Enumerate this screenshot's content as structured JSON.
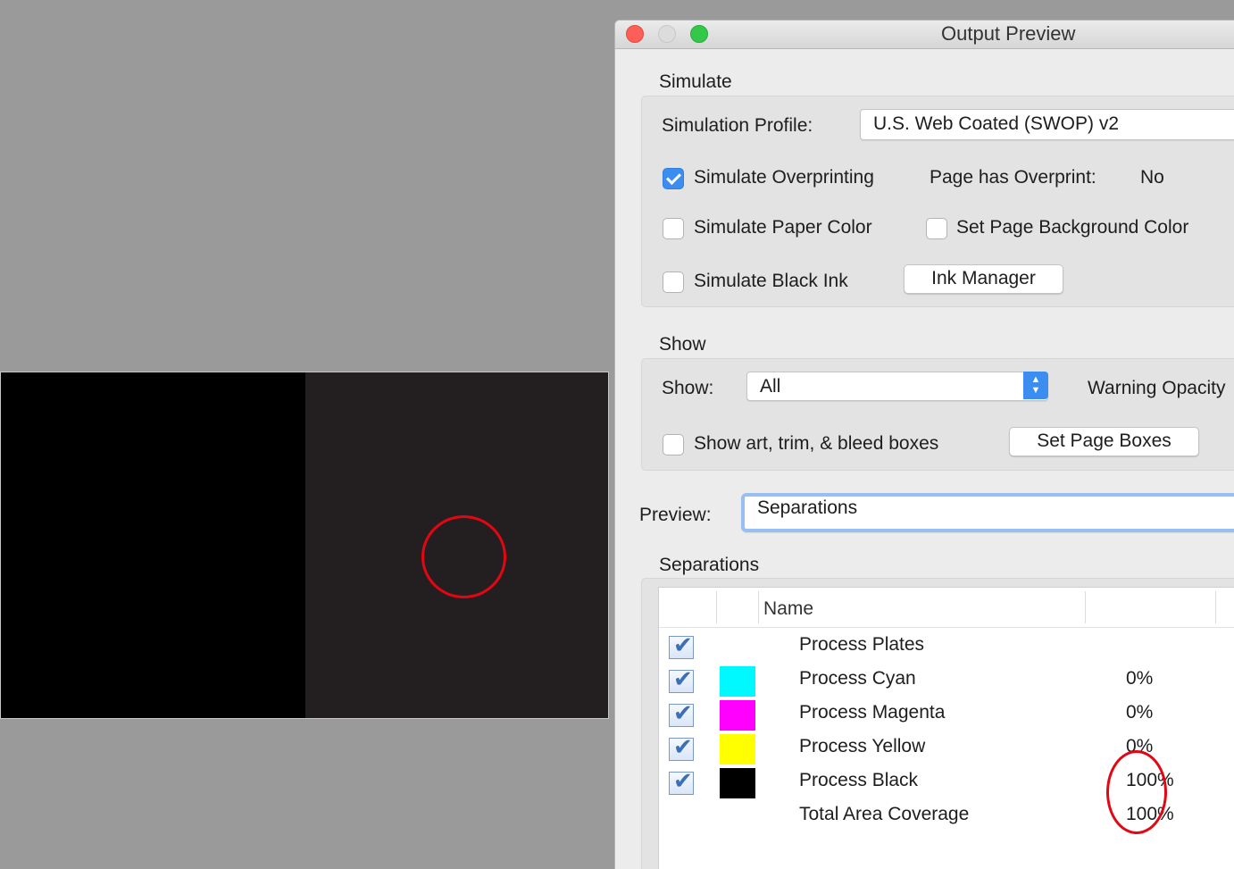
{
  "window": {
    "title": "Output Preview"
  },
  "simulate": {
    "section_label": "Simulate",
    "profile_label": "Simulation Profile:",
    "profile_value": "U.S. Web Coated (SWOP) v2",
    "overprint_label": "Simulate Overprinting",
    "overprint_checked": true,
    "page_overprint_label": "Page has Overprint:",
    "page_overprint_value": "No",
    "paper_color_label": "Simulate Paper Color",
    "bg_color_label": "Set Page Background Color",
    "black_ink_label": "Simulate Black Ink",
    "ink_manager_label": "Ink Manager"
  },
  "show": {
    "section_label": "Show",
    "show_label": "Show:",
    "show_value": "All",
    "warning_label": "Warning Opacity",
    "boxes_label": "Show art, trim, & bleed boxes",
    "set_boxes_label": "Set Page Boxes"
  },
  "preview": {
    "label": "Preview:",
    "value": "Separations"
  },
  "separations": {
    "section_label": "Separations",
    "header_name": "Name",
    "rows": [
      {
        "name": "Process Plates",
        "checked": true,
        "swatch": "",
        "pct": ""
      },
      {
        "name": "Process Cyan",
        "checked": true,
        "swatch": "#00f8ff",
        "pct": "0%"
      },
      {
        "name": "Process Magenta",
        "checked": true,
        "swatch": "#ff00ff",
        "pct": "0%"
      },
      {
        "name": "Process Yellow",
        "checked": true,
        "swatch": "#ffff00",
        "pct": "0%"
      },
      {
        "name": "Process Black",
        "checked": true,
        "swatch": "#000000",
        "pct": "100%"
      },
      {
        "name": "Total Area Coverage",
        "checked": false,
        "swatch": "",
        "pct": "100%"
      }
    ]
  },
  "colors": {
    "accent": "#3b8ef0",
    "annotation": "#e30613"
  }
}
